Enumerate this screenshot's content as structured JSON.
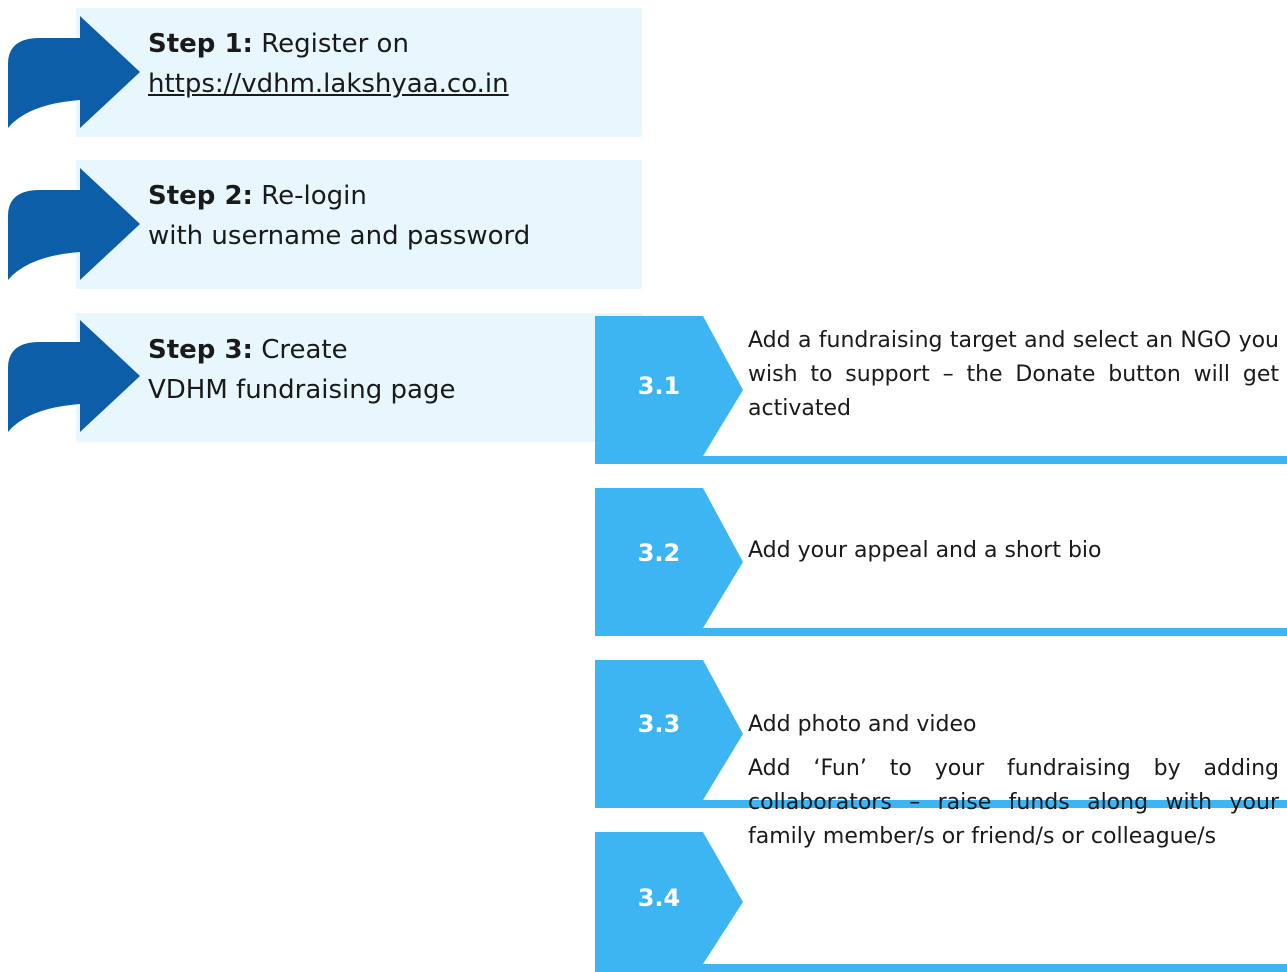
{
  "colors": {
    "step_box_bg": "#e8f6fd",
    "step_arrow": "#0c5ea8",
    "sub_accent": "#3db5f2"
  },
  "steps": [
    {
      "label": "Step 1:",
      "text": "Register on",
      "line2": "https://vdhm.lakshyaa.co.in"
    },
    {
      "label": "Step 2:",
      "text": "Re-login",
      "line2": "with username and password"
    },
    {
      "label": "Step 3:",
      "text": "Create",
      "line2": "VDHM fundraising page"
    }
  ],
  "substeps": [
    {
      "number": "3.1",
      "text": "Add a fundraising target and select an NGO you wish to support – the Donate button will get activated"
    },
    {
      "number": "3.2",
      "text": "Add your appeal and a short bio"
    },
    {
      "number": "3.3",
      "text": "Add photo and video"
    },
    {
      "number": "3.4",
      "text": "Add ‘Fun’ to your fundraising by adding collaborators – raise funds along with your family member/s or friend/s or colleague/s"
    }
  ]
}
